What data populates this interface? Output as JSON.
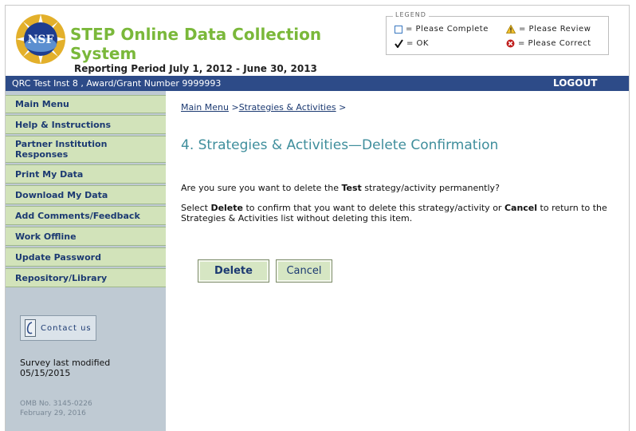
{
  "header": {
    "title": "STEP Online Data Collection System",
    "period": "Reporting Period July 1, 2012 - June 30, 2013",
    "logo_text": "NSF"
  },
  "legend": {
    "title": "LEGEND",
    "items": [
      {
        "icon": "empty-square-icon",
        "label": "= Please Complete"
      },
      {
        "icon": "warning-triangle-icon",
        "label": "= Please Review"
      },
      {
        "icon": "checkmark-icon",
        "label": "= OK"
      },
      {
        "icon": "red-x-circle-icon",
        "label": "= Please Correct"
      }
    ]
  },
  "topbar": {
    "context": "QRC Test Inst 8 , Award/Grant Number 9999993",
    "logout": "LOGOUT"
  },
  "sidebar": {
    "items": [
      {
        "label": "Main Menu"
      },
      {
        "label": "Help & Instructions"
      },
      {
        "label": "Partner Institution Responses"
      },
      {
        "label": "Print My Data"
      },
      {
        "label": "Download My Data"
      },
      {
        "label": "Add Comments/Feedback"
      },
      {
        "label": "Work Offline"
      },
      {
        "label": "Update Password"
      },
      {
        "label": "Repository/Library"
      }
    ],
    "contact_label": "Contact us",
    "modified_label": "Survey last modified",
    "modified_date": "05/15/2015",
    "omb_number": "OMB No. 3145-0226",
    "omb_date": "February 29, 2016"
  },
  "main": {
    "breadcrumb": {
      "home": "Main Menu",
      "sep1": " >",
      "section": "Strategies & Activities",
      "sep2": " >"
    },
    "title": "4. Strategies & Activities—Delete Confirmation",
    "question_pre": "Are you sure you want to delete the ",
    "question_item": "Test",
    "question_post": " strategy/activity permanently?",
    "instr_1": "Select ",
    "instr_delete": "Delete",
    "instr_2": " to confirm that you want to delete this strategy/activity or ",
    "instr_cancel": "Cancel",
    "instr_3": " to return to the Strategies & Activities list without deleting this item.",
    "delete_button": "Delete",
    "cancel_button": "Cancel"
  },
  "colors": {
    "title_green": "#7ab83a",
    "topbar_blue": "#2d4b88",
    "nav_green": "#d2e3ba",
    "sidebar_gray": "#bfcad3",
    "heading_teal": "#3f8e9c"
  }
}
